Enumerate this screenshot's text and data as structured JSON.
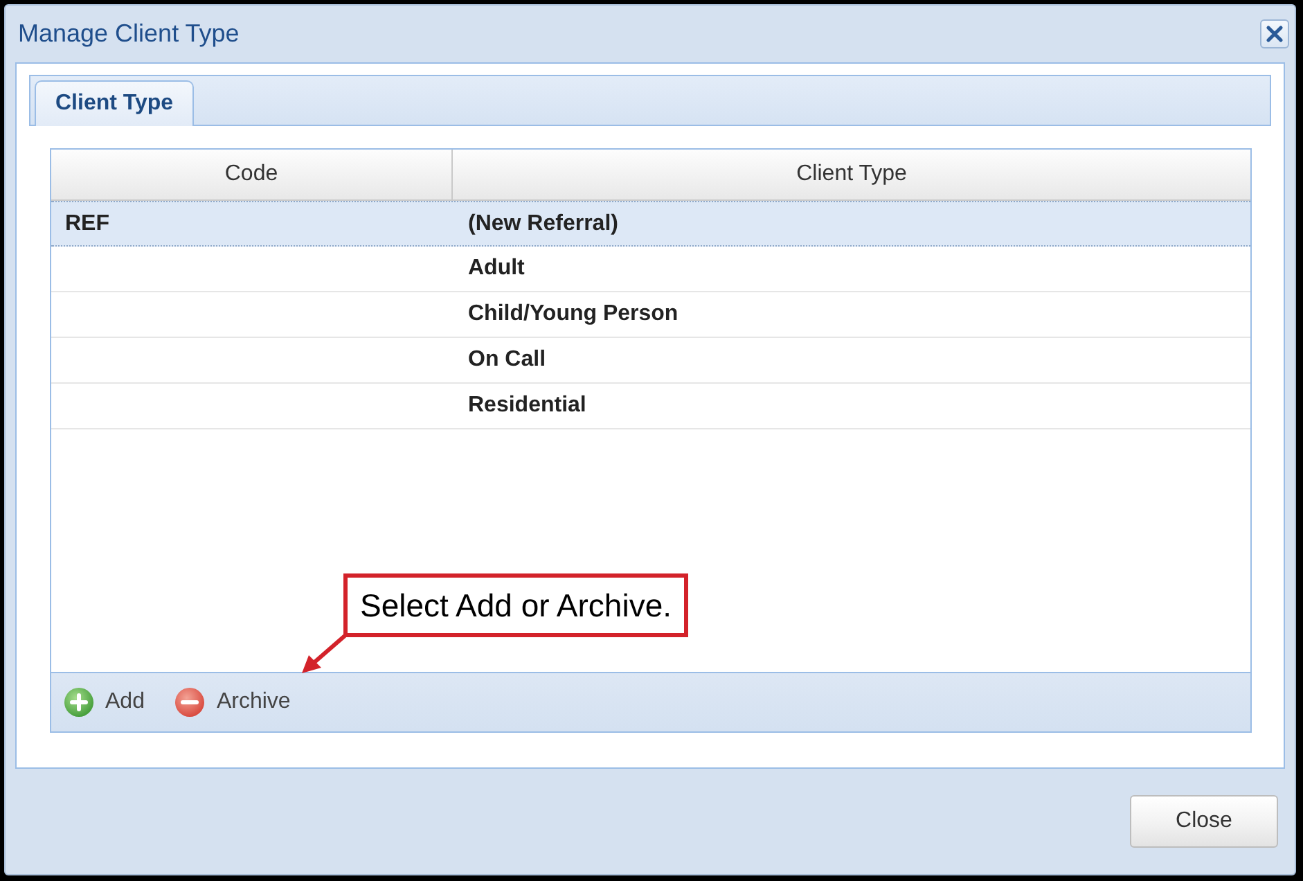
{
  "window": {
    "title": "Manage Client Type"
  },
  "tabs": [
    {
      "label": "Client Type",
      "selected": true
    }
  ],
  "table": {
    "columns": [
      "Code",
      "Client Type"
    ],
    "rows": [
      {
        "code": "REF",
        "client_type": "(New Referral)",
        "selected": true
      },
      {
        "client_type": "Adult",
        "selected": false
      },
      {
        "client_type": "Child/Young Person",
        "selected": false
      },
      {
        "client_type": "On Call",
        "selected": false
      },
      {
        "client_type": "Residential",
        "selected": false
      }
    ]
  },
  "toolbar": [
    {
      "label": "Add",
      "kind": "add"
    },
    {
      "label": "Archive",
      "kind": "archive"
    }
  ],
  "callout": {
    "text": "Select Add or Archive."
  },
  "buttons": [
    {
      "label": "Close"
    }
  ]
}
